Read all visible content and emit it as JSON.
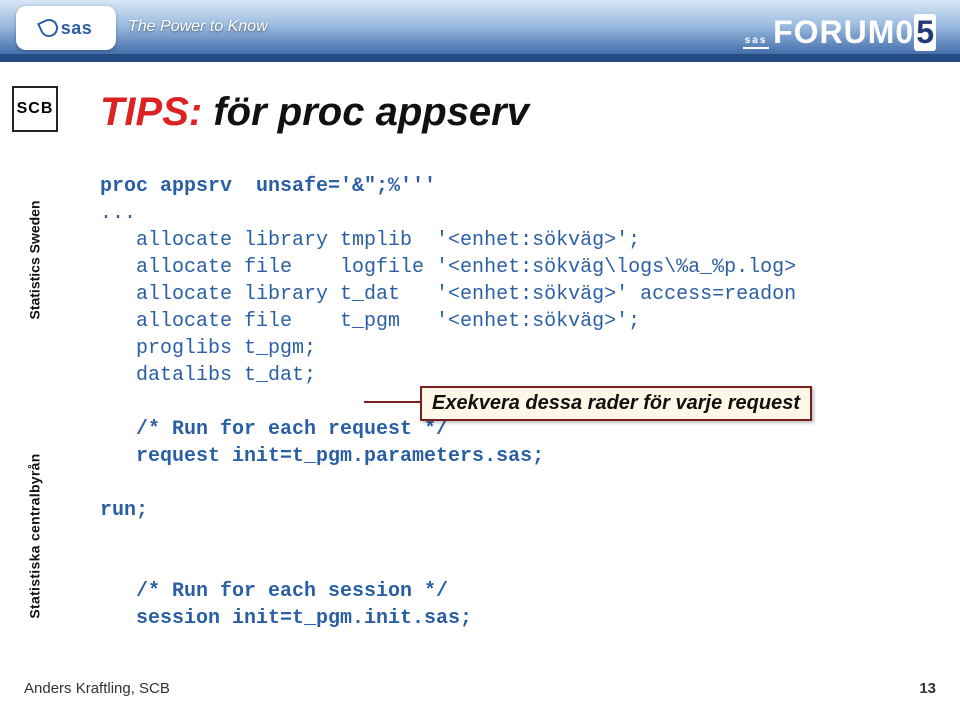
{
  "header": {
    "sas": "sas",
    "tagline": "The Power to Know",
    "forum_prefix": "sas",
    "forum_word": "FORUM",
    "forum_zero": "0",
    "forum_five": "5"
  },
  "sidebar": {
    "scb": "SCB",
    "line1": "Statistics Sweden",
    "line2": "Statistiska centralbyrån"
  },
  "title": {
    "tips": "TIPS:",
    "rest": " för proc appserv"
  },
  "code": {
    "l1": "proc appsrv  unsafe='&\";%'''",
    "l2": "...",
    "l3": "   allocate library tmplib  '<enhet:sökväg>';",
    "l4": "   allocate file    logfile '<enhet:sökväg\\logs\\%a_%p.log>",
    "l5": "   allocate library t_dat   '<enhet:sökväg>' access=readon",
    "l6": "   allocate file    t_pgm   '<enhet:sökväg>';",
    "l7": "   proglibs t_pgm;",
    "l8": "   datalibs t_dat;",
    "l9": "   /* Run for each request */",
    "l10": "   request init=t_pgm.parameters.sas;",
    "l11": "run;",
    "l12": "   /* Run for each session */",
    "l13": "   session init=t_pgm.init.sas;"
  },
  "callout": "Exekvera dessa rader för varje request",
  "footer": {
    "author": "Anders Kraftling, SCB",
    "page": "13"
  }
}
